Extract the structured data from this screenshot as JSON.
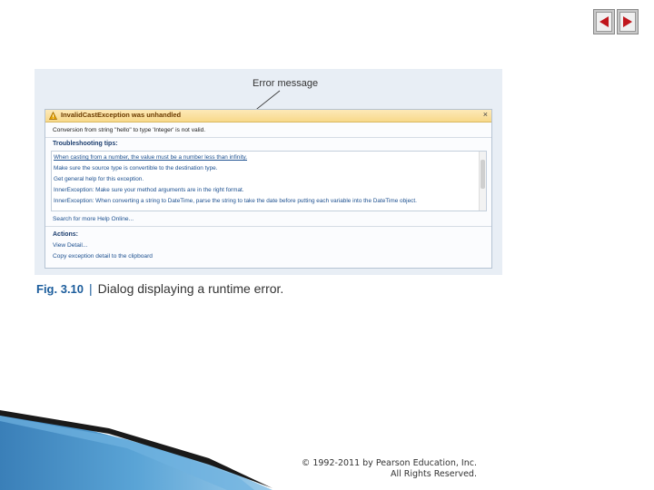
{
  "nav": {
    "prev_icon": "left-triangle-icon",
    "next_icon": "right-triangle-icon",
    "accent": "#c0161c"
  },
  "callout": {
    "text": "Error message"
  },
  "dialog": {
    "title": "InvalidCastException was unhandled",
    "message": "Conversion from string \"hello\" to type 'Integer' is not valid.",
    "tips_label": "Troubleshooting tips:",
    "tips": [
      "When casting from a number, the value must be a number less than infinity.",
      "Make sure the source type is convertible to the destination type.",
      "Get general help for this exception.",
      "InnerException: Make sure your method arguments are in the right format.",
      "InnerException: When converting a string to DateTime, parse the string to take the date before putting each variable into the DateTime object."
    ],
    "search_help": "Search for more Help Online...",
    "actions_label": "Actions:",
    "actions": [
      "View Detail...",
      "Copy exception detail to the clipboard"
    ]
  },
  "caption": {
    "fig": "Fig. 3.10",
    "separator": "|",
    "text": "Dialog displaying a runtime error."
  },
  "footer": {
    "line1": "© 1992-2011 by Pearson Education, Inc.",
    "line2": "All Rights Reserved."
  }
}
